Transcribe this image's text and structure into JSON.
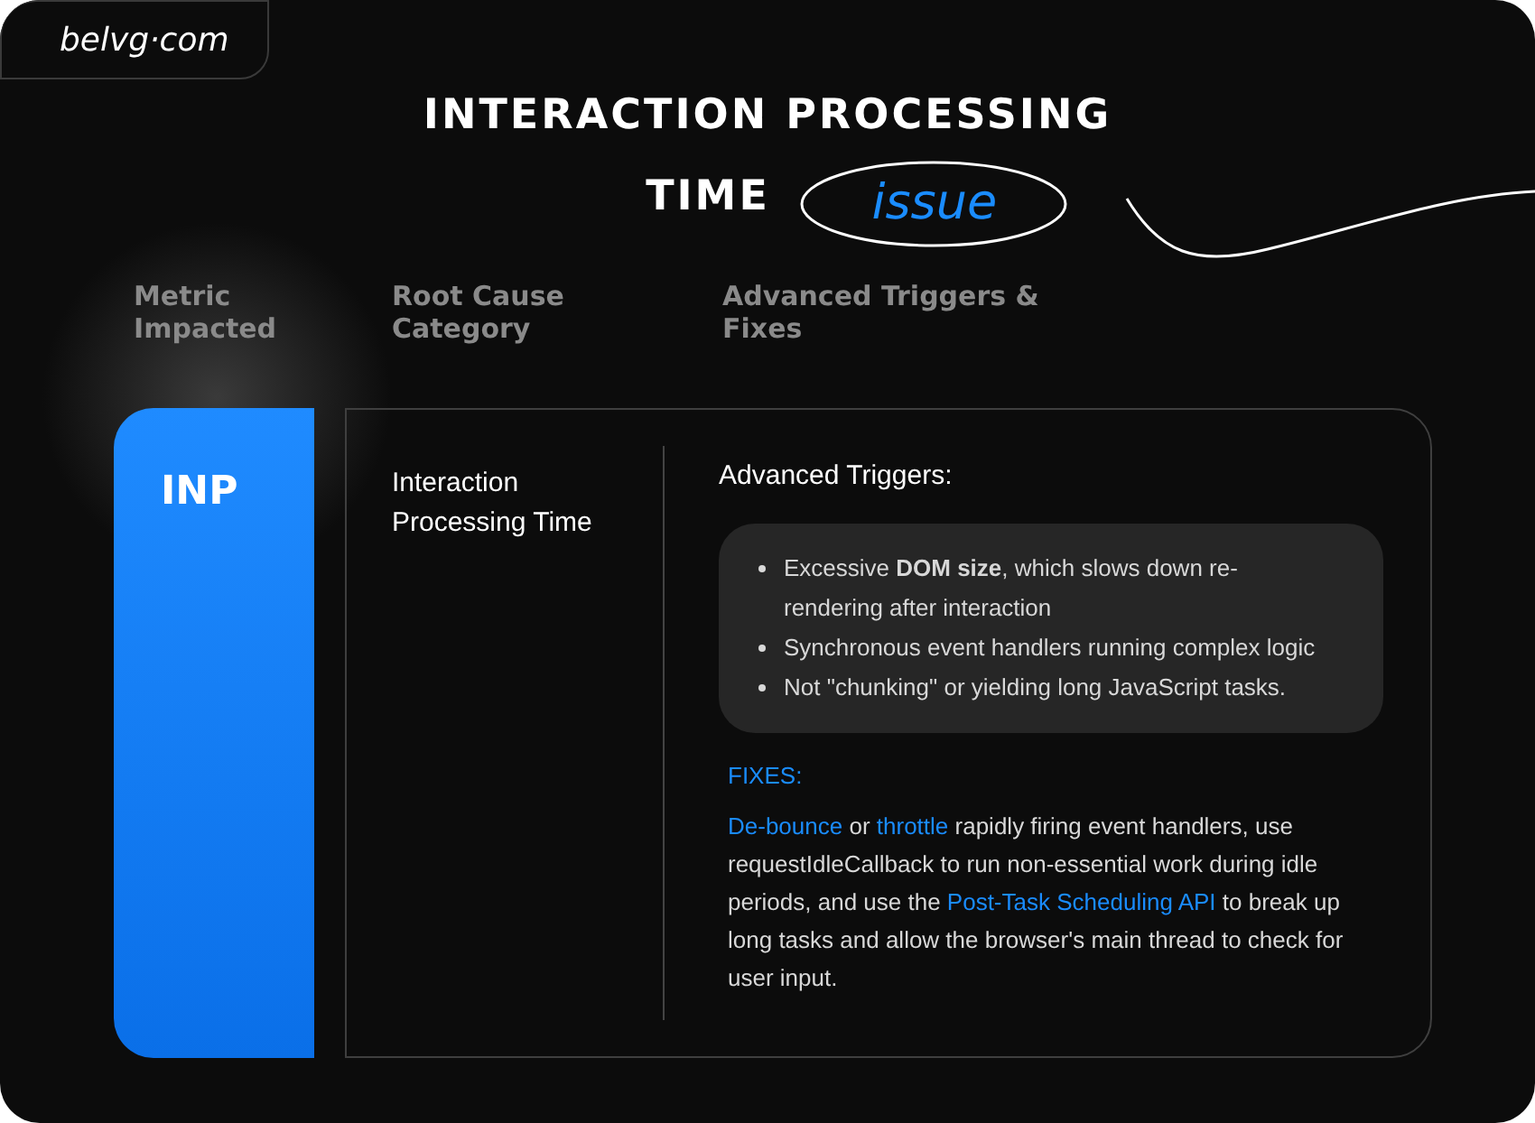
{
  "logo": "belvg·com",
  "title": {
    "line_1": "INTERACTION PROCESSING",
    "line_2": "TIME",
    "tag": "issue"
  },
  "columns": [
    "Metric Impacted",
    "Root Cause Category",
    "Advanced Triggers & Fixes"
  ],
  "row": {
    "metric": "INP",
    "category": "Interaction Processing Time",
    "triggers_heading": "Advanced Triggers:",
    "triggers": [
      "Excessive **DOM size**, which slows down re-rendering after interaction",
      "Synchronous event handlers running complex logic",
      "Not \"chunking\" or yielding long JavaScript tasks."
    ],
    "fixes_heading": "FIXES:",
    "fixes": [
      {
        "text": "De-bounce",
        "highlight": true
      },
      {
        "text": " or ",
        "highlight": false
      },
      {
        "text": "throttle",
        "highlight": true
      },
      {
        "text": " rapidly firing event handlers, use requestIdleCallback to run non-essential work during idle periods, and use the ",
        "highlight": false
      },
      {
        "text": "Post-Task Scheduling API",
        "highlight": true
      },
      {
        "text": " to break up long tasks and allow the browser's main thread to check for user input.",
        "highlight": false
      }
    ]
  }
}
